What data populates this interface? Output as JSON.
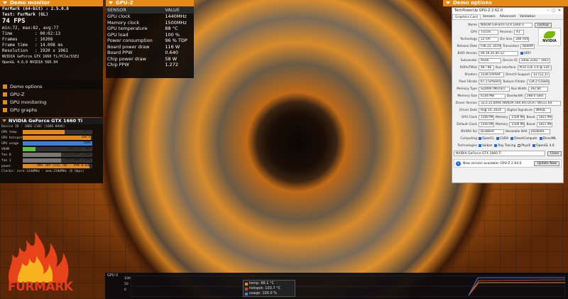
{
  "demo_monitor": {
    "header": "Demo monitor",
    "app": "FurMark (64-bit) : 2.5.0.0",
    "test": "Test: FurMark (GL)",
    "fps": "74 FPS",
    "minmax": "min:72, max:82, avg:77",
    "stats": [
      {
        "k": "Time",
        "v": ": 00:02:13"
      },
      {
        "k": "Frames",
        "v": ": 10208"
      },
      {
        "k": "Frame time",
        "v": ": 14.098 ms"
      },
      {
        "k": "Resolution",
        "v": ": 1920 x 1061"
      }
    ],
    "renderer": "NVIDIA GeForce GTX 1660 Ti/PCIe/SSE2",
    "gl": "OpenGL 4.6.0 NVIDIA 560.94",
    "options": [
      "Demo options",
      "GPU-Z",
      "GPU monitoring",
      "GPU graphs"
    ]
  },
  "gpu_monitor": {
    "title": "NVIDIA GeForce GTX 1660 Ti",
    "device": "Device ID : 10DE-2182 (10DE-8AA8)",
    "rows": [
      {
        "label": "GPU temp",
        "value": "88°C",
        "fill": 0.6,
        "color": "#e58a16"
      },
      {
        "label": "GPU hotspot",
        "value": "104°C",
        "fill": 0.98,
        "color": "#e58a16"
      },
      {
        "label": "GPU usage",
        "value": "100%",
        "fill": 1.0,
        "color": "#3a7fe0"
      },
      {
        "label": "VRAM",
        "value": "18% (857 MB)",
        "fill": 0.18,
        "color": "#5bc23a"
      },
      {
        "label": "fan 0",
        "value": "4473 RPM (55%)",
        "fill": 0.55,
        "color": "#777"
      },
      {
        "label": "fan 1",
        "value": "3440 RPM (55%)",
        "fill": 0.55,
        "color": "#777"
      },
      {
        "label": "power",
        "value": "96% TDP (115.7W) - PPW 0.640",
        "fill": 0.96,
        "color": "#e58a16"
      }
    ],
    "clocks": "Clocks:   core:1440MHz - mem:1500MHz (6 Gbps)"
  },
  "gpuz_panel": {
    "header": "GPU-Z",
    "columns": [
      "SENSOR",
      "VALUE"
    ],
    "rows": [
      [
        "GPU clock",
        "1440MHz"
      ],
      [
        "Memory clock",
        "1500MHz"
      ],
      [
        "GPU temperature",
        "88 °C"
      ],
      [
        "GPU load",
        "100 %"
      ],
      [
        "Power consumption",
        "96 % TDP"
      ],
      [
        "Board power draw",
        "116 W"
      ],
      [
        "Board PPW",
        "0.640"
      ],
      [
        "Chip power draw",
        "58 W"
      ],
      [
        "Chip PPW",
        "1.272"
      ]
    ]
  },
  "demo_options_header": "Demo options",
  "gpuz_window": {
    "title": "TechPowerUp GPU-Z 2.62.0",
    "tabs": [
      "Graphics Card",
      "Sensors",
      "Advanced",
      "Validation"
    ],
    "name": "NVIDIA GeForce GTX 1660 Ti",
    "lookup": "Lookup",
    "gpu": "TU116",
    "revision": "A1",
    "technology": "12 nm",
    "die_size": "284 mm²",
    "release_date": "Feb 22, 2019",
    "transistors": "6600M",
    "bios": "90.16.20.40.52",
    "uefi": "UEFI",
    "subvendor": "ASUS",
    "device_id": "10DE 2182 - 1043 86A0",
    "rops_tmus": "48 / 96",
    "bus_interface": "PCIe x16 3.0 @ x16 3.0",
    "shaders": "1536 Unified",
    "directx": "12 (12_1)",
    "pixel_fillrate": "67.1 GPixel/s",
    "texture_fillrate": "134.2 GTexel/s",
    "memory_type": "GDDR6 (Micron)",
    "bus_width": "192 bit",
    "memory_size": "6144 MB",
    "bandwidth": "288.0 GB/s",
    "driver_version": "32.0.15.6094 (NVIDIA 560.94) DCH / Win11 64",
    "driver_date": "Aug 14, 2024",
    "digital_signature": "WHQL",
    "gpu_clock": "1500 MHz",
    "memory": "1500 MHz",
    "boost": "1815 MHz",
    "default_clock": "1500 MHz",
    "default_memory": "1500 MHz",
    "default_boost": "1815 MHz",
    "nvidia_sli": "Disabled",
    "resizable_bar": "Disabled",
    "computing": [
      "OpenCL",
      "CUDA",
      "DirectCompute",
      "DirectML"
    ],
    "technologies": [
      "Vulkan",
      "Ray Tracing",
      "PhysX",
      "OpenGL 4.6"
    ],
    "labels": {
      "name": "Name",
      "gpu": "GPU",
      "revision": "Revision",
      "technology": "Technology",
      "die_size": "Die Size",
      "release_date": "Release Date",
      "transistors": "Transistors",
      "bios": "BIOS Version",
      "subvendor": "Subvendor",
      "device_id": "Device ID",
      "rops": "ROPs/TMUs",
      "bus": "Bus Interface",
      "shaders": "Shaders",
      "directx": "DirectX Support",
      "pixel": "Pixel Fillrate",
      "texture": "Texture Fillrate",
      "memtype": "Memory Type",
      "buswidth": "Bus Width",
      "memsize": "Memory Size",
      "bandwidth": "Bandwidth",
      "driver": "Driver Version",
      "driverdate": "Driver Date",
      "digsig": "Digital Signature",
      "gpuclock": "GPU Clock",
      "memory": "Memory",
      "boost": "Boost",
      "defclock": "Default Clock",
      "sli": "NVIDIA SLI",
      "rebar": "Resizable BAR",
      "computing": "Computing",
      "tech": "Technologies"
    },
    "selected_gpu": "NVIDIA GeForce GTX 1660 Ti",
    "close": "Close",
    "update_notice": "New version available: GPU-Z 2.64.0",
    "update_now": "Update Now",
    "logo_text": "NVIDIA"
  },
  "graph": {
    "label": "GPU 0",
    "ticks": [
      "100",
      "50",
      "0"
    ],
    "legend": [
      {
        "text": "temp: 88.1 °C",
        "color": "#e58a16"
      },
      {
        "text": "hotspot: 103.7 °C",
        "color": "#d04010"
      },
      {
        "text": "usage: 100.0 %",
        "color": "#3a7fe0"
      }
    ]
  },
  "logo": {
    "text": "FURMARK"
  }
}
